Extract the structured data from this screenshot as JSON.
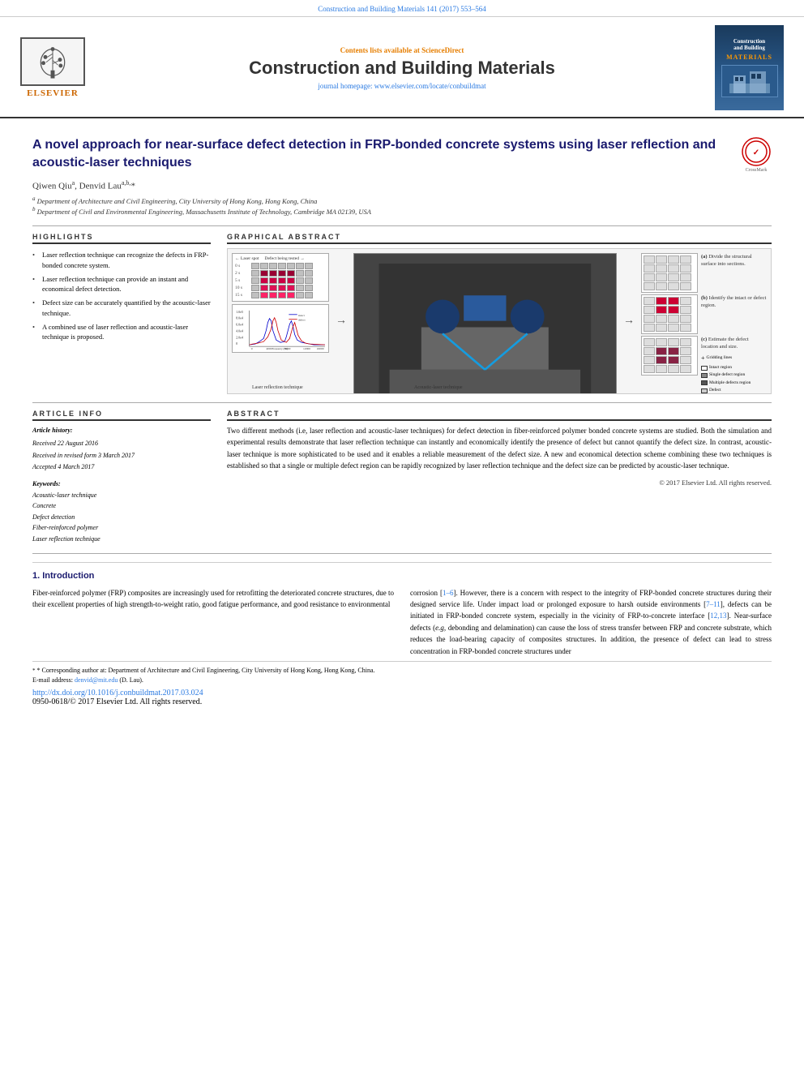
{
  "page": {
    "top_ref": "Construction and Building Materials 141 (2017) 553–564",
    "header": {
      "contents_available": "Contents lists available at",
      "science_direct": "ScienceDirect",
      "journal_title": "Construction and Building Materials",
      "homepage_prefix": "journal homepage: ",
      "homepage_url": "www.elsevier.com/locate/conbuildmat",
      "elsevier_label": "ELSEVIER",
      "cover_title": "Construction and Building Materials",
      "cover_materials": "MATERIALS"
    },
    "article": {
      "title": "A novel approach for near-surface defect detection in FRP-bonded concrete systems using laser reflection and acoustic-laser techniques",
      "authors": "Qiwen Qiuᵃ, Denvid Lauᵃᵇ*",
      "affiliations": [
        "ᵃ Department of Architecture and Civil Engineering, City University of Hong Kong, Hong Kong, China",
        "ᵇ Department of Civil and Environmental Engineering, Massachusetts Institute of Technology, Cambridge MA 02139, USA"
      ]
    },
    "highlights": {
      "header": "HIGHLIGHTS",
      "items": [
        "Laser reflection technique can recognize the defects in FRP-bonded concrete system.",
        "Laser reflection technique can provide an instant and economical defect detection.",
        "Defect size can be accurately quantified by the acoustic-laser technique.",
        "A combined use of laser reflection and acoustic-laser technique is proposed."
      ]
    },
    "graphical_abstract": {
      "header": "GRAPHICAL ABSTRACT",
      "laser_label": "Laser reflection technique",
      "acoustic_label": "Acoustic-laser technique",
      "legend": {
        "gridding_lines": "Gridding lines",
        "intact_region": "Intact region",
        "single_defect": "Single defect region",
        "multiple_defects": "Multiple defects region",
        "defect": "Defect"
      },
      "side_labels": [
        "(a) Divide the structural surface into sections.",
        "(b) Identify the intact or defect region.",
        "(c) Estimate the defect location and size."
      ]
    },
    "article_info": {
      "header": "ARTICLE INFO",
      "history_label": "Article history:",
      "received": "Received 22 August 2016",
      "received_revised": "Received in revised form 3 March 2017",
      "accepted": "Accepted 4 March 2017",
      "keywords_label": "Keywords:",
      "keywords": [
        "Acoustic-laser technique",
        "Concrete",
        "Defect detection",
        "Fiber-reinforced polymer",
        "Laser reflection technique"
      ]
    },
    "abstract": {
      "header": "ABSTRACT",
      "text": "Two different methods (i.e, laser reflection and acoustic-laser techniques) for defect detection in fiber-reinforced polymer bonded concrete systems are studied. Both the simulation and experimental results demonstrate that laser reflection technique can instantly and economically identify the presence of defect but cannot quantify the defect size. In contrast, acoustic-laser technique is more sophisticated to be used and it enables a reliable measurement of the defect size. A new and economical detection scheme combining these two techniques is established so that a single or multiple defect region can be rapidly recognized by laser reflection technique and the defect size can be predicted by acoustic-laser technique.",
      "copyright": "© 2017 Elsevier Ltd. All rights reserved."
    },
    "introduction": {
      "header": "1. Introduction",
      "left_col": "Fiber-reinforced polymer (FRP) composites are increasingly used for retrofitting the deteriorated concrete structures, due to their excellent properties of high strength-to-weight ratio, good fatigue performance, and good resistance to environmental",
      "right_col": "corrosion [1–6]. However, there is a concern with respect to the integrity of FRP-bonded concrete structures during their designed service life. Under impact load or prolonged exposure to harsh outside environments [7–11], defects can be initiated in FRP-bonded concrete system, especially in the vicinity of FRP-to-concrete interface [12,13]. Near-surface defects (e.g, debonding and delamination) can cause the loss of stress transfer between FRP and concrete substrate, which reduces the load-bearing capacity of composites structures. In addition, the presence of defect can lead to stress concentration in FRP-bonded concrete structures under"
    },
    "footnote": {
      "star_note": "* Corresponding author at: Department of Architecture and Civil Engineering, City University of Hong Kong, Hong Kong, China.",
      "email_label": "E-mail address:",
      "email": "denvid@mit.edu",
      "email_suffix": "(D. Lau).",
      "doi_link": "http://dx.doi.org/10.1016/j.conbuildmat.2017.03.024",
      "issn_line": "0950-0618/© 2017 Elsevier Ltd. All rights reserved."
    }
  }
}
